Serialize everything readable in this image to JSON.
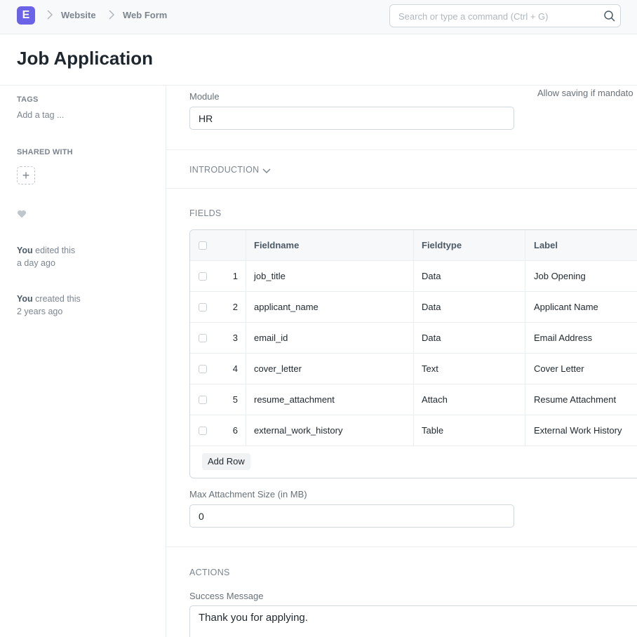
{
  "navbar": {
    "logo_letter": "E",
    "breadcrumbs": [
      "Website",
      "Web Form"
    ],
    "search_placeholder": "Search or type a command (Ctrl + G)",
    "brand_color": "#6a62e7"
  },
  "page": {
    "title": "Job Application"
  },
  "sidebar": {
    "tags_label": "TAGS",
    "add_tag": "Add a tag ...",
    "shared_with_label": "SHARED WITH",
    "share_add_symbol": "+",
    "activity": [
      {
        "actor": "You",
        "action": " edited this",
        "when": "a day ago"
      },
      {
        "actor": "You",
        "action": " created this",
        "when": "2 years ago"
      }
    ]
  },
  "form": {
    "module_label": "Module",
    "module_value": "HR",
    "allow_saving_text": "Allow saving if mandato",
    "introduction_label": "INTRODUCTION",
    "fields_label": "FIELDS",
    "max_attachment_label": "Max Attachment Size (in MB)",
    "max_attachment_value": "0",
    "actions_label": "ACTIONS",
    "success_message_label": "Success Message",
    "success_message_value": "Thank you for applying."
  },
  "fields_table": {
    "columns": [
      "Fieldname",
      "Fieldtype",
      "Label"
    ],
    "rows": [
      {
        "idx": "1",
        "fieldname": "job_title",
        "fieldtype": "Data",
        "label": "Job Opening"
      },
      {
        "idx": "2",
        "fieldname": "applicant_name",
        "fieldtype": "Data",
        "label": "Applicant Name"
      },
      {
        "idx": "3",
        "fieldname": "email_id",
        "fieldtype": "Data",
        "label": "Email Address"
      },
      {
        "idx": "4",
        "fieldname": "cover_letter",
        "fieldtype": "Text",
        "label": "Cover Letter"
      },
      {
        "idx": "5",
        "fieldname": "resume_attachment",
        "fieldtype": "Attach",
        "label": "Resume Attachment"
      },
      {
        "idx": "6",
        "fieldname": "external_work_history",
        "fieldtype": "Table",
        "label": "External Work History"
      }
    ],
    "add_row_label": "Add Row"
  }
}
